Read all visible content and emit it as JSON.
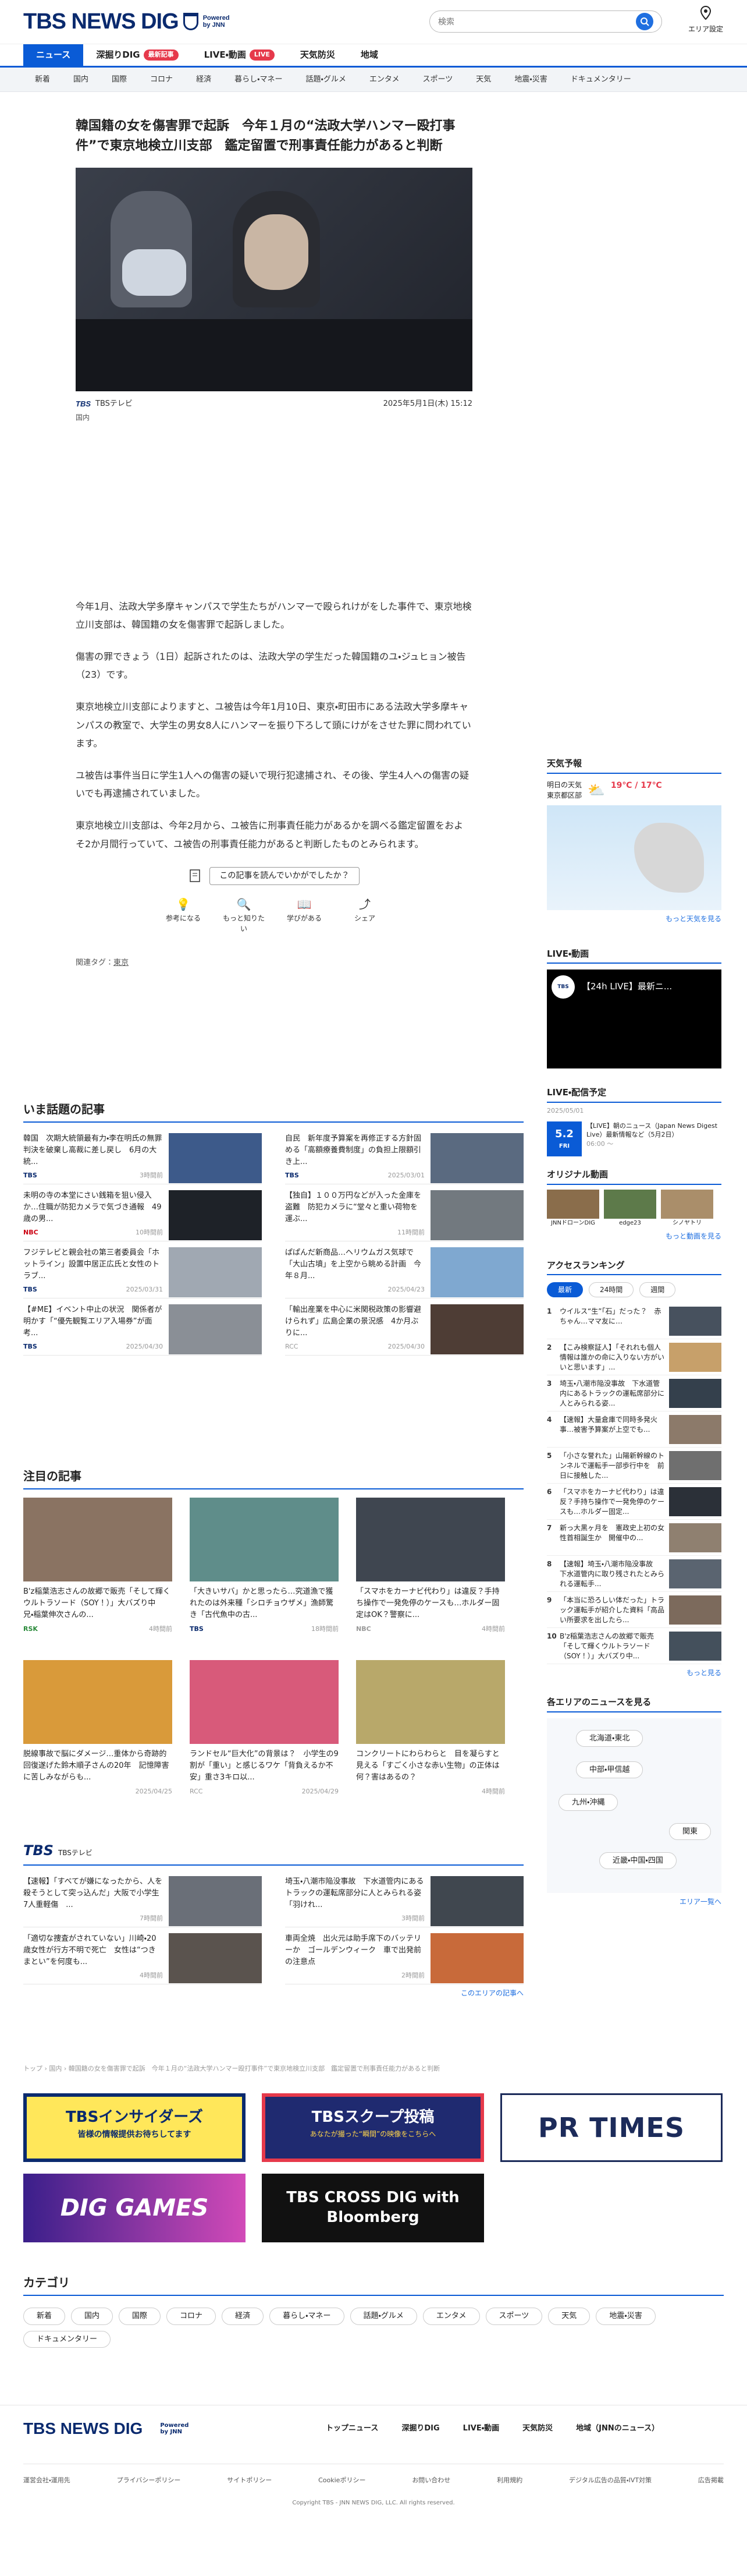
{
  "header": {
    "logo": "TBS NEWS DIG",
    "powered": "Powered by JNN",
    "search_placeholder": "検索",
    "area_label": "エリア設定"
  },
  "nav_primary": [
    {
      "label": "ニュース",
      "active": true
    },
    {
      "label": "深掘りDIG",
      "badge": "最新記事"
    },
    {
      "label": "LIVE・動画",
      "badge": "LIVE"
    },
    {
      "label": "天気防災"
    },
    {
      "label": "地域"
    }
  ],
  "nav_secondary": [
    "新着",
    "国内",
    "国際",
    "コロナ",
    "経済",
    "暮らし・マネー",
    "話題・グルメ",
    "エンタメ",
    "スポーツ",
    "天気",
    "地震・災害",
    "ドキュメンタリー"
  ],
  "article": {
    "title": "韓国籍の女を傷害罪で起訴　今年１月の“法政大学ハンマー殴打事件”で東京地検立川支部　鑑定留置で刑事責任能力があると判断",
    "source": "TBSテレビ",
    "datetime": "2025年5月1日(木) 15:12",
    "category": "国内",
    "paragraphs": [
      "今年1月、法政大学多摩キャンパスで学生たちがハンマーで殴られけがをした事件で、東京地検立川支部は、韓国籍の女を傷害罪で起訴しました。",
      "傷害の罪できょう（1日）起訴されたのは、法政大学の学生だった韓国籍のユ・ジュヒョン被告（23）です。",
      "東京地検立川支部によりますと、ユ被告は今年1月10日、東京・町田市にある法政大学多摩キャンパスの教室で、大学生の男女8人にハンマーを振り下ろして頭にけがをさせた罪に問われています。",
      "ユ被告は事件当日に学生1人への傷害の疑いで現行犯逮捕され、その後、学生4人への傷害の疑いでも再逮捕されていました。",
      "東京地検立川支部は、今年2月から、ユ被告に刑事責任能力があるかを調べる鑑定留置をおよそ2か月間行っていて、ユ被告の刑事責任能力があると判断したものとみられます。"
    ],
    "feedback_label": "この記事を読んでいかがでしたか？",
    "reactions": [
      "参考になる",
      "もっと知りたい",
      "学びがある",
      "シェア"
    ],
    "tags_label": "関連タグ：",
    "tag": "東京"
  },
  "trending": {
    "title": "いま話題の記事",
    "items": [
      {
        "text": "韓国　次期大統領最有力・李在明氏の無罪判決を破棄し高裁に差し戻し　6月の大統...",
        "src": "TBS",
        "time": "3時間前"
      },
      {
        "text": "自民　新年度予算案を再修正する方針固める「高額療養費制度」の負担上限額引き上...",
        "src": "TBS",
        "time": "2025/03/01"
      },
      {
        "text": "未明の寺の本堂にさい銭箱を狙い侵入か…住職が防犯カメラで気づき通報　49歳の男...",
        "src": "NBC",
        "time": "10時間前"
      },
      {
        "text": "【独自】１００万円などが入った金庫を盗難　防犯カメラに“堂々と重い荷物を運ぶ...",
        "src": "",
        "time": "11時間前"
      },
      {
        "text": "フジテレビと親会社の第三者委員会「ホットライン」設置中居正広氏と女性のトラブ...",
        "src": "TBS",
        "time": "2025/03/31"
      },
      {
        "text": "ぱぱんだ新商品…ヘリウムガス気球で「大山古墳」を上空から眺める計画　今年８月...",
        "src": "",
        "time": "2025/04/23"
      },
      {
        "text": "【#ME】イベント中止の状況　関係者が明かす「“優先観覧エリア入場券”が面考...",
        "src": "TBS",
        "time": "2025/04/30"
      },
      {
        "text": "「輸出産業を中心に米関税政策の影響避けられず」広島企業の景況感　4か月ぶりに...",
        "src": "RCC",
        "time": "2025/04/30"
      }
    ]
  },
  "featured": {
    "title": "注目の記事",
    "items": [
      {
        "text": "B'z稲葉浩志さんの故郷で販売「そして輝くウルトラソード（SOY！）」大バズり中　兄・稲葉伸次さんの...",
        "src": "RSK",
        "time": "4時間前"
      },
      {
        "text": "「大きいサバ」かと思ったら…究道漁で獲れたのは外来種「シロチョウザメ」漁師驚き「古代魚中の古...",
        "src": "TBS",
        "time": "18時間前"
      },
      {
        "text": "「スマホをカーナビ代わり」は違反？手持ち操作で一発免停のケースも…ホルダー固定はOK？警察に...",
        "src": "NBC",
        "time": "4時間前"
      },
      {
        "text": "脱線事故で脳にダメージ…重体から奇跡的回復遂げた鈴木順子さんの20年　記憶障害に苦しみながらも...",
        "src": "",
        "time": "2025/04/25"
      },
      {
        "text": "ランドセル“巨大化”の背景は？　小学生の9割が「重い」と感じるワケ「背負えるか不安」重さ3キロ以...",
        "src": "RCC",
        "time": "2025/04/29"
      },
      {
        "text": "コンクリートにわらわらと　目を凝らすと見える「すごく小さな赤い生物」の正体は何？害はあるの？",
        "src": "",
        "time": "4時間前"
      }
    ]
  },
  "tbs_block": {
    "title": "TBS",
    "subtitle": "TBSテレビ",
    "items": [
      {
        "text": "【速報】「すべてが嫌になったから、人を殺そうとして突っ込んだ」大阪で小学生7人重軽傷　...",
        "time": "7時間前"
      },
      {
        "text": "埼玉・八潮市陥没事故　下水道管内にあるトラックの運転席部分に人とみられる姿「羽けれ...",
        "time": "3時間前"
      },
      {
        "text": "「適切な捜査がされていない」川崎・20歳女性が行方不明で死亡　女性は“つきまとい”を何度も...",
        "time": "4時間前"
      },
      {
        "text": "車両全焼　出火元は助手席下のバッテリーか　ゴールデンウィーク　車で出発前の注意点",
        "time": "2時間前"
      }
    ],
    "more": "このエリアの記事へ"
  },
  "breadcrumb": "トップ › 国内 › 韓国籍の女を傷害罪で起訴　今年１月の“法政大学ハンマー殴打事件”で東京地検立川支部　鑑定留置で刑事責任能力があると判断",
  "banners": [
    "TBSインサイダーズ",
    "TBSスクープ投稿",
    "PR TIMES",
    "DIG GAMES",
    "TBS CROSS DIG with Bloomberg"
  ],
  "banner_sub": [
    "皆様の情報提供お待ちしてます",
    "あなたが撮った“瞬間”の映像をこちらへ"
  ],
  "categories": {
    "title": "カテゴリ",
    "items": [
      "新着",
      "国内",
      "国際",
      "コロナ",
      "経済",
      "暮らし・マネー",
      "話題・グルメ",
      "エンタメ",
      "スポーツ",
      "天気",
      "地震・災害",
      "ドキュメンタリー"
    ]
  },
  "footer": {
    "nav": [
      "トップニュース",
      "深掘りDIG",
      "LIVE・動画",
      "天気防災",
      "地域（JNNのニュース）"
    ],
    "links": [
      "運営会社・運用先",
      "プライバシーポリシー",
      "サイトポリシー",
      "Cookieポリシー",
      "お問い合わせ",
      "利用規約",
      "デジタル広告の品質・IVT対策",
      "広告掲載"
    ],
    "copyright": "Copyright TBS - JNN NEWS DIG, LLC. All rights reserved."
  },
  "sidebar": {
    "weather": {
      "title": "天気予報",
      "loc1": "明日の天気",
      "loc2": "東京都区部",
      "temps": "19℃ / 17℃",
      "more": "もっと天気を見る"
    },
    "live": {
      "title": "LIVE・動画",
      "video_title": "【24h LIVE】最新ニ...",
      "more": ""
    },
    "schedule": {
      "title": "LIVE・配信予定",
      "date": "2025/05/01",
      "day": "5.2",
      "weekday": "FRI",
      "program": "【LIVE】朝のニュース（Japan News Digest Live）最新情報など（5月2日）",
      "time": "06:00 〜"
    },
    "original": {
      "title": "オリジナル動画",
      "items": [
        "JNNドローンDIG",
        "edge23",
        "シノヤトリ"
      ],
      "more": "もっと動画を見る"
    },
    "ranking": {
      "title": "アクセスランキング",
      "tabs": [
        "最新",
        "24時間",
        "週間"
      ],
      "items": [
        "ウイルス“生”「石」だった？　赤ちゃん…ママ友に…",
        "【こみ検察証人】「それれも個人情報は誰かの命に入りない方がいいと思います」...",
        "埼玉・八潮市陥没事故　下水道管内にあるトラックの運転席部分に人とみられる姿...",
        "【速報】大量倉庫で同時多発火事…被害予算案が上空でも...",
        "「小さな誉れた」山陽新幹線のトンネルで運転手一部歩行中を　前日に接触した...",
        "「スマホをカーナビ代わり」は違反？手持ち操作で一発免停のケースも…ホルダー固定...",
        "新っ大黒ヶ月を　憲政史上初の女性首相誕生か　開催中の...",
        "【速報】埼玉・八潮市陥没事故　下水道管内に取り残されたとみられる運転手...",
        "「本当に恐ろしい体だった」トラック運転手が紹介した資料「高品い所要求を出したら...",
        "B'z稲葉浩志さんの故郷で販売「そして輝くウルトラソード（SOY！）」大バズり中..."
      ],
      "more": "もっと見る"
    },
    "area": {
      "title": "各エリアのニュースを見る",
      "regions": [
        "北海道・東北",
        "中部・甲信越",
        "九州・沖縄",
        "関東",
        "近畿・中国・四国"
      ],
      "more": "エリア一覧へ"
    }
  },
  "colors": {
    "brand": "#0a2a6e",
    "accent": "#0a5bd6",
    "alert": "#e6394b"
  }
}
